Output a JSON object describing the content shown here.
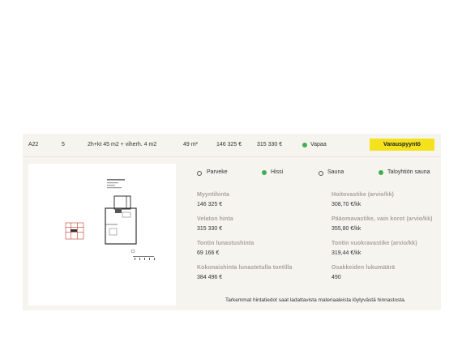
{
  "row": {
    "id": "A22",
    "floor": "5",
    "layout": "2h+kt 45 m2 + viherh. 4 m2",
    "area": "49 m²",
    "sale_price": "146 325 €",
    "debt_free_price": "315 330 €",
    "status": "Vapaa",
    "status_color": "#3fb04f",
    "reserve_button": "Varauspyyntö"
  },
  "features": [
    {
      "label": "Parveke",
      "available": false
    },
    {
      "label": "Hissi",
      "available": true
    },
    {
      "label": "Sauna",
      "available": false
    },
    {
      "label": "Taloyhtiön sauna",
      "available": true
    }
  ],
  "details": {
    "myyntihinta_label": "Myyntihinta",
    "myyntihinta_value": "146 325 €",
    "hoitovastike_label": "Hoitovastike (arvio/kk)",
    "hoitovastike_value": "308,70 €/kk",
    "velaton_label": "Velaton hinta",
    "velaton_value": "315 330 €",
    "paaomavastike_label": "Pääomavastike, vain korot (arvio/kk)",
    "paaomavastike_value": "355,80 €/kk",
    "lunastus_label": "Tontin lunastushinta",
    "lunastus_value": "69 166 €",
    "vuokravastike_label": "Tontin vuokravastike (arvio/kk)",
    "vuokravastike_value": "319,44 €/kk",
    "kokonaishinta_label": "Kokonaishinta lunastetulla tontilla",
    "kokonaishinta_value": "384 496 €",
    "osakkeet_label": "Osakkeiden lukumäärä",
    "osakkeet_value": "490"
  },
  "footnote": "Tarkemmat hintatiedot saat ladattavista materiaaleista löytyvästä hinnastosta.",
  "colors": {
    "accent": "#f3e21d",
    "card_bg": "#f6f4ef",
    "label_gray": "#a6a39c"
  }
}
